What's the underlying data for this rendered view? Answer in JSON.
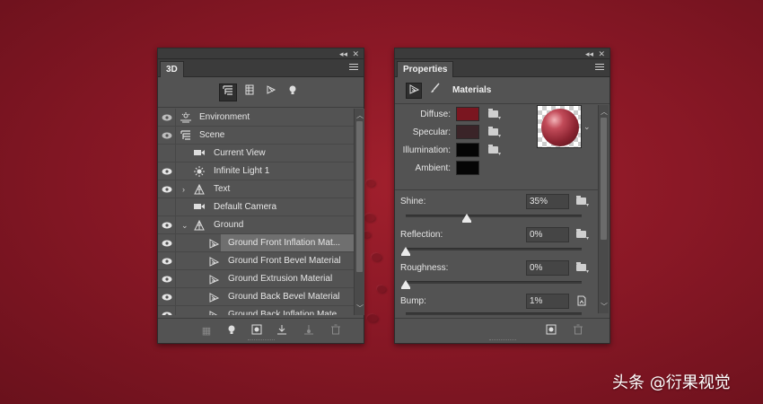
{
  "panel_3d": {
    "tab_label": "3D",
    "filter_buttons": [
      "scene-filter-icon",
      "mesh-filter-icon",
      "material-filter-icon",
      "light-filter-icon"
    ],
    "rows": [
      {
        "label": "Environment",
        "icon": "environment-icon",
        "visible": true
      },
      {
        "label": "Scene",
        "icon": "scene-icon",
        "visible": true
      },
      {
        "label": "Current View",
        "icon": "camera-icon",
        "visible": true
      },
      {
        "label": "Infinite Light 1",
        "icon": "light-icon",
        "visible": true
      },
      {
        "label": "Text",
        "icon": "mesh-icon",
        "visible": true,
        "collapsed": true
      },
      {
        "label": "Default Camera",
        "icon": "camera-icon",
        "visible": true
      },
      {
        "label": "Ground",
        "icon": "mesh-icon",
        "visible": true,
        "expanded": true
      },
      {
        "label": "Ground Front Inflation Mat...",
        "icon": "material-icon",
        "visible": true,
        "selected": true
      },
      {
        "label": "Ground Front Bevel Material",
        "icon": "material-icon",
        "visible": true
      },
      {
        "label": "Ground Extrusion Material",
        "icon": "material-icon",
        "visible": true
      },
      {
        "label": "Ground Back Bevel Material",
        "icon": "material-icon",
        "visible": true
      },
      {
        "label": "Ground Back Inflation Mate...",
        "icon": "material-icon",
        "visible": true
      }
    ]
  },
  "panel_properties": {
    "tab_label": "Properties",
    "section_title": "Materials",
    "textures": [
      {
        "label": "Diffuse:",
        "color": "#7a1620"
      },
      {
        "label": "Specular:",
        "color": "#3a2428"
      },
      {
        "label": "Illumination:",
        "color": "#050505"
      },
      {
        "label": "Ambient:",
        "color": "#050505"
      }
    ],
    "params": [
      {
        "label": "Shine:",
        "value": "35%",
        "level": 0.35
      },
      {
        "label": "Reflection:",
        "value": "0%",
        "level": 0
      },
      {
        "label": "Roughness:",
        "value": "0%",
        "level": 0
      },
      {
        "label": "Bump:",
        "value": "1%",
        "level": 0.01
      }
    ]
  },
  "watermark": "头条 @衍果视觉"
}
